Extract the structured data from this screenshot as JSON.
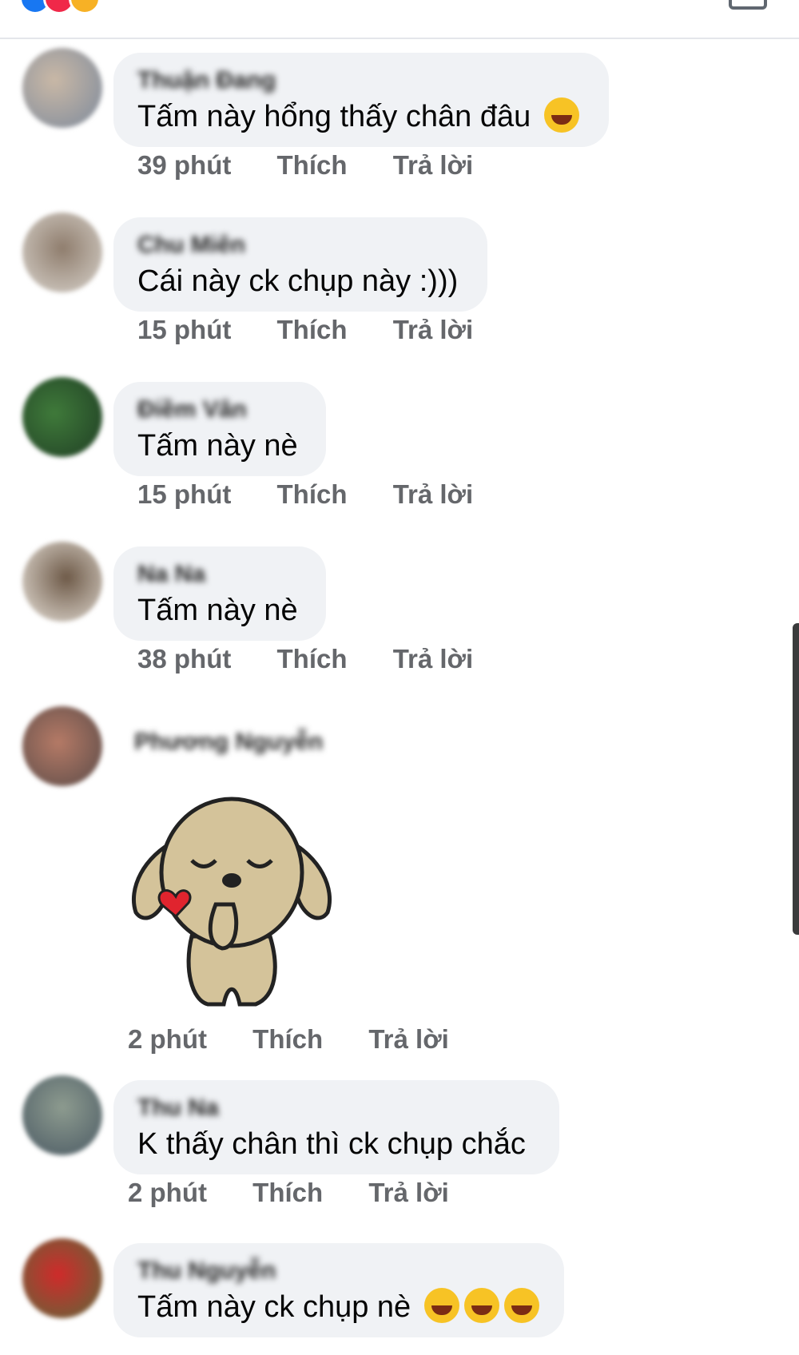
{
  "comments": [
    {
      "name": "Thuận Đang",
      "text": "Tấm này hổng thấy chân đâu",
      "emoji": [
        "laughing-tears-emoji"
      ],
      "time": "39 phút",
      "like": "Thích",
      "reply": "Trả lời"
    },
    {
      "name": "Chu Miên",
      "text": "Cái này ck chụp này :)))",
      "time": "15 phút",
      "like": "Thích",
      "reply": "Trả lời"
    },
    {
      "name": "Điềm Vân",
      "text": "Tấm này nè",
      "time": "15 phút",
      "like": "Thích",
      "reply": "Trả lời"
    },
    {
      "name": "Na Na",
      "text": "Tấm này nè",
      "time": "38 phút",
      "like": "Thích",
      "reply": "Trả lời"
    },
    {
      "name": "Phương Nguyễn",
      "sticker": "dog-blowing-kiss-sticker",
      "time": "2 phút",
      "like": "Thích",
      "reply": "Trả lời"
    },
    {
      "name": "Thu Na",
      "text": "K thấy chân thì ck chụp chắc",
      "time": "2 phút",
      "like": "Thích",
      "reply": "Trả lời"
    },
    {
      "name": "Thu Nguyễn",
      "text": "Tấm này ck chụp nè",
      "emoji": [
        "tears-of-joy-emoji",
        "tears-of-joy-emoji",
        "tears-of-joy-emoji"
      ]
    }
  ],
  "colors": {
    "bubble": "#f0f2f5",
    "meta_text": "#65676b",
    "body_text": "#050505"
  }
}
